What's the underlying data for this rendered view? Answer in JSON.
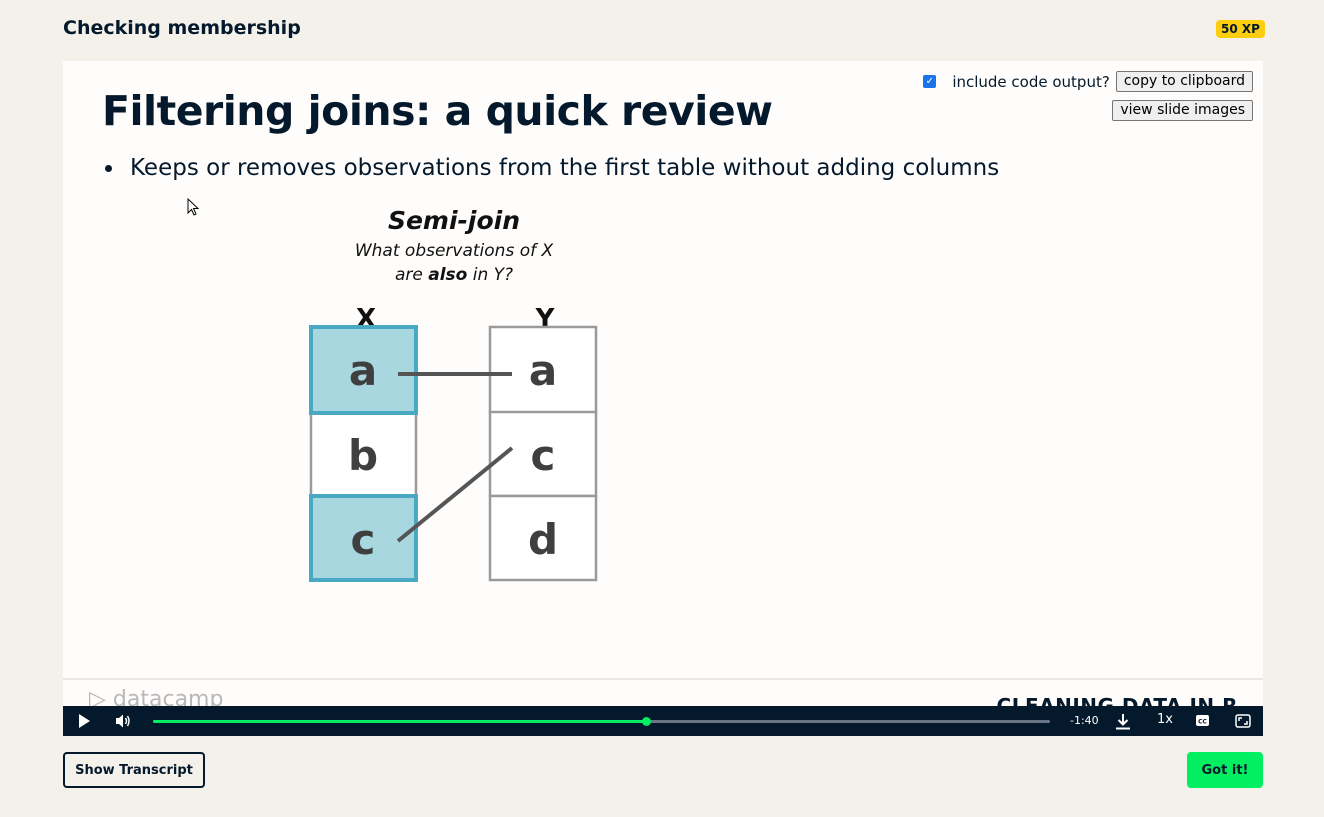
{
  "header": {
    "title": "Checking membership",
    "xp": "50 XP"
  },
  "slide": {
    "title": "Filtering joins: a quick review",
    "bullet": "Keeps or removes observations from the first table without adding columns",
    "diagram": {
      "title": "Semi-join",
      "subtitle_line1": "What observations of X",
      "subtitle_line2_pre": "are ",
      "subtitle_line2_bold": "also",
      "subtitle_line2_post": " in Y?",
      "left_label": "X",
      "right_label": "Y",
      "left_cells": [
        "a",
        "b",
        "c"
      ],
      "right_cells": [
        "a",
        "c",
        "d"
      ]
    },
    "footer_logo": "datacamp",
    "footer_course": "CLEANING DATA IN R"
  },
  "slide_controls": {
    "include_output_label": "include code output?",
    "include_output_checked": true,
    "copy_label": "copy to clipboard",
    "view_images_label": "view slide images"
  },
  "player": {
    "progress": 0.55,
    "time_remaining": "-1:40",
    "speed": "1x"
  },
  "actions": {
    "transcript_label": "Show Transcript",
    "got_it_label": "Got it!"
  },
  "colors": {
    "accent_green": "#03ef62",
    "navy": "#05192d",
    "highlight_cell": "#a8d7e0",
    "highlight_border": "#4aa9c2",
    "xp_yellow": "#fcce0d"
  }
}
